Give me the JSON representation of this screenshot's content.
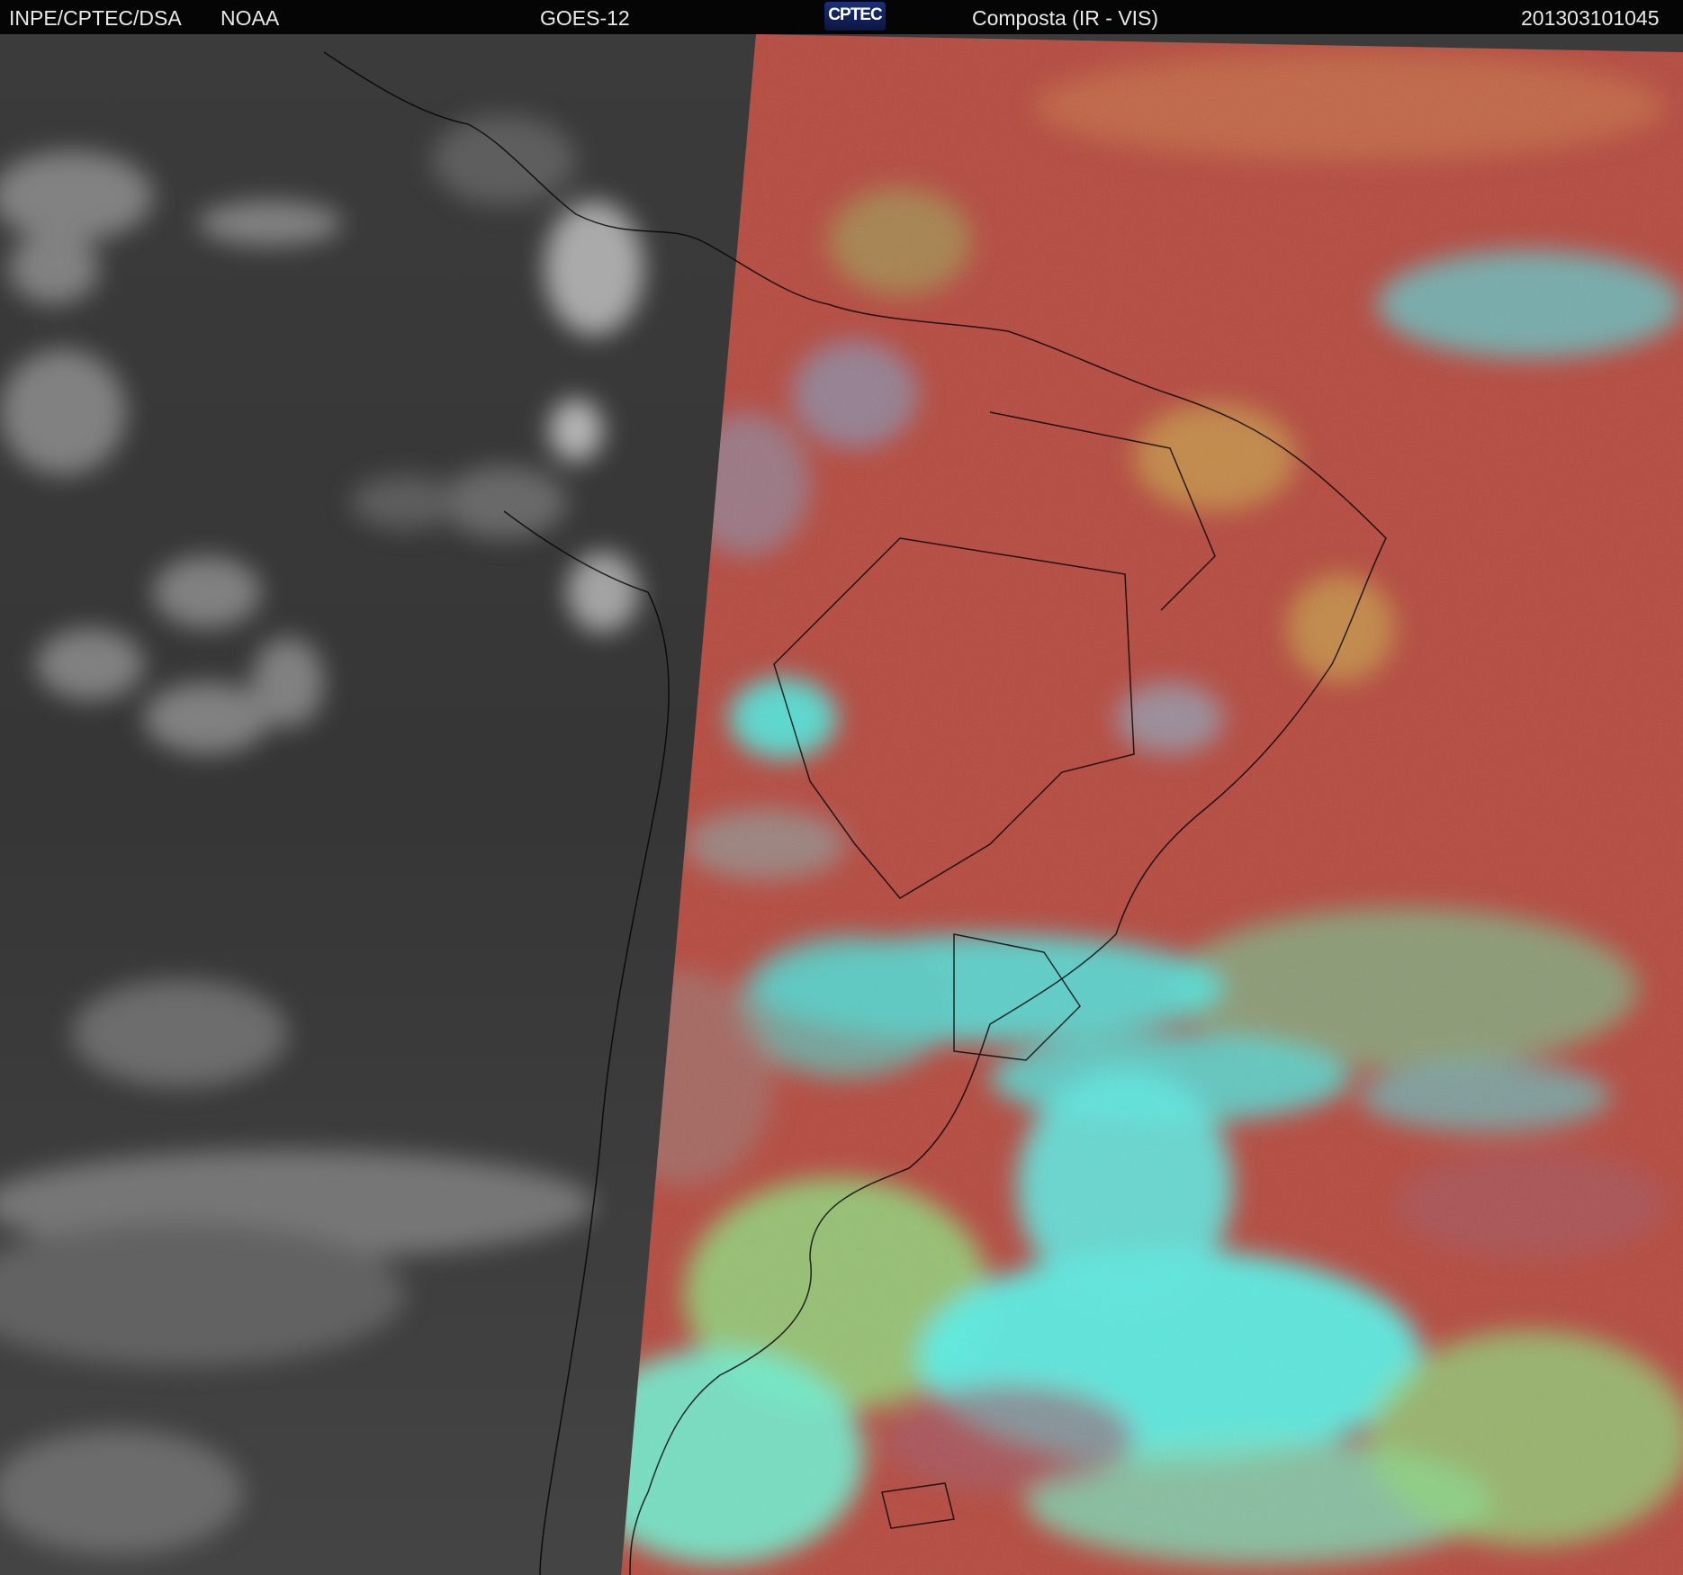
{
  "header": {
    "institution": "INPE/CPTEC/DSA",
    "agency": "NOAA",
    "satellite": "GOES-12",
    "logo_text": "CPTEC",
    "product": "Composta (IR - VIS)",
    "timestamp": "201303101045"
  },
  "colors": {
    "header_bg": "#050505",
    "ir_gray": "#3a3a3a",
    "composite_red": "#b5473c",
    "cloud_cyan": "#4ff0e0",
    "cloud_green": "#8fd67a",
    "coastline": "#000000"
  },
  "icons": {
    "logo": "cptec-logo"
  }
}
